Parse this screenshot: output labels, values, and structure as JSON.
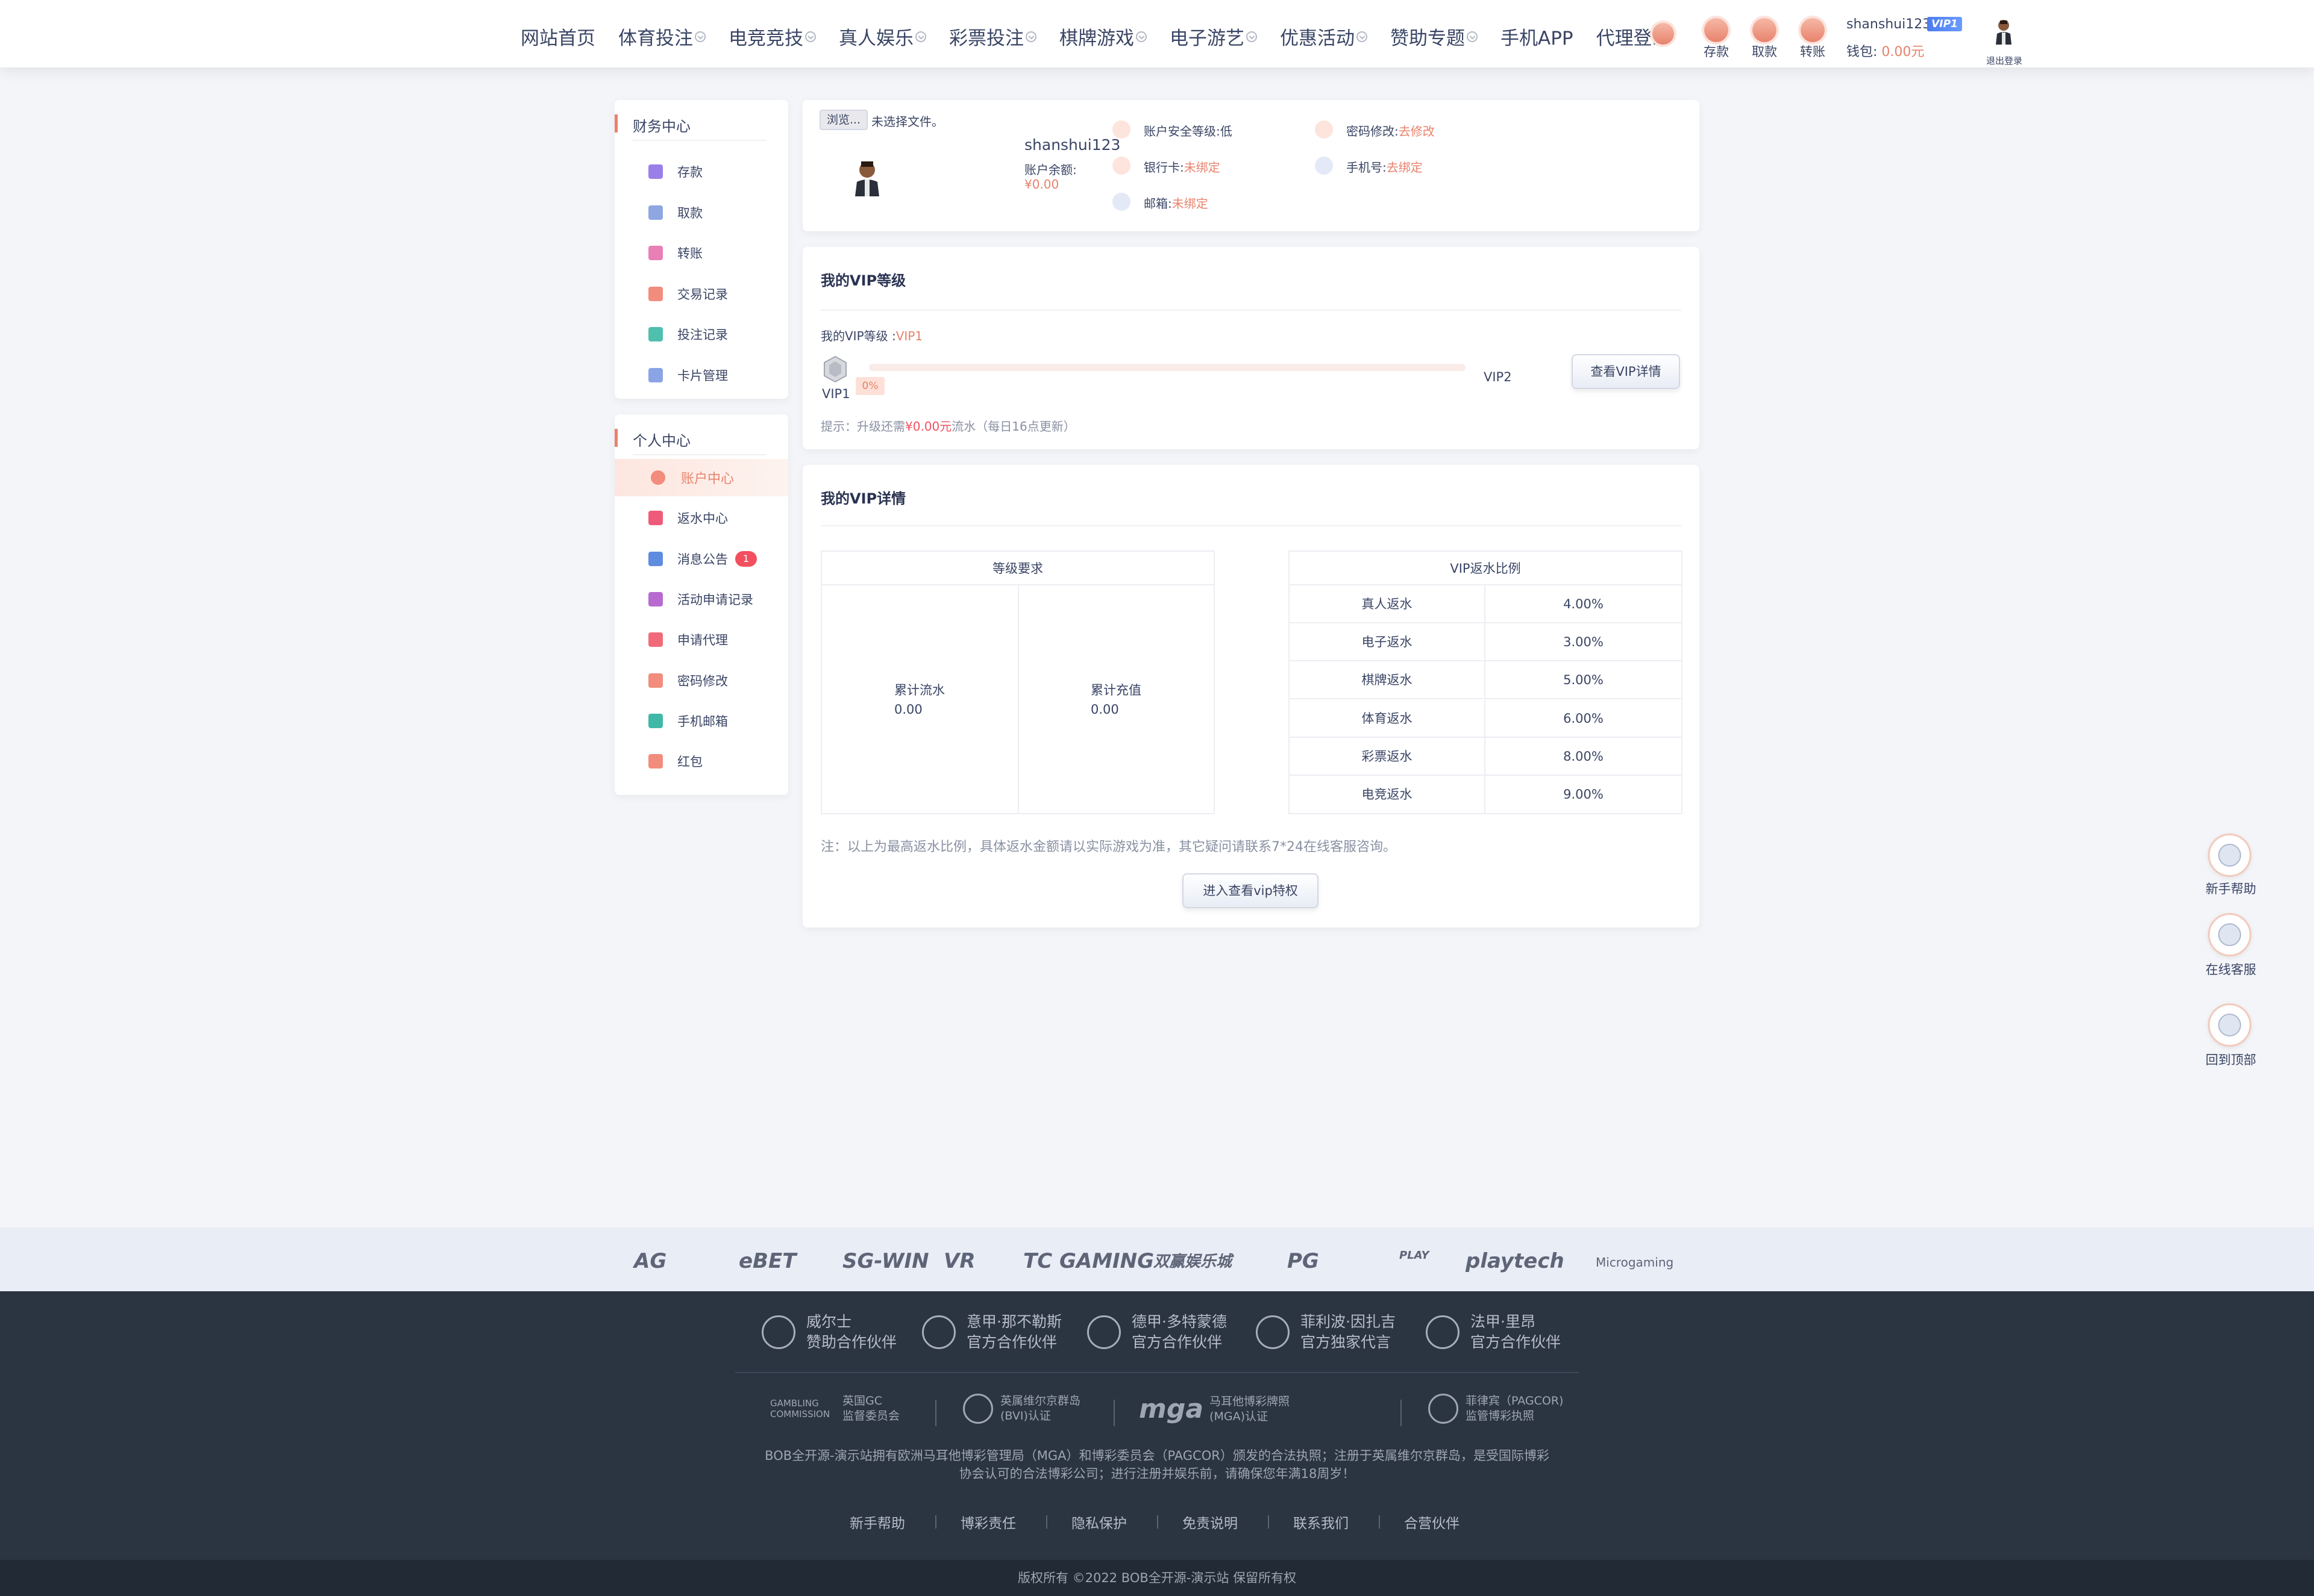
{
  "nav": {
    "items": [
      {
        "label": "网站首页",
        "chev": false
      },
      {
        "label": "体育投注",
        "chev": true
      },
      {
        "label": "电竞竞技",
        "chev": true
      },
      {
        "label": "真人娱乐",
        "chev": true
      },
      {
        "label": "彩票投注",
        "chev": true
      },
      {
        "label": "棋牌游戏",
        "chev": true
      },
      {
        "label": "电子游艺",
        "chev": true
      },
      {
        "label": "优惠活动",
        "chev": true
      },
      {
        "label": "赞助专题",
        "chev": true
      },
      {
        "label": "手机APP",
        "chev": false
      },
      {
        "label": "代理登录",
        "chev": false
      }
    ]
  },
  "header": {
    "deposit": "存款",
    "withdraw": "取款",
    "transfer": "转账",
    "username": "shanshui123",
    "vip_badge": "VIP1",
    "wallet_label": "钱包:",
    "wallet_amount": "0.00",
    "wallet_unit": "元",
    "logout": "退出登录"
  },
  "sidebar": {
    "finance_title": "财务中心",
    "finance_items": [
      "存款",
      "取款",
      "转账",
      "交易记录",
      "投注记录",
      "卡片管理"
    ],
    "personal_title": "个人中心",
    "personal_items": [
      "账户中心",
      "返水中心",
      "消息公告",
      "活动申请记录",
      "申请代理",
      "密码修改",
      "手机邮箱",
      "红包"
    ],
    "message_badge": "1"
  },
  "profile": {
    "browse_btn": "浏览...",
    "no_file": "未选择文件。",
    "username": "shanshui123",
    "balance_label": "账户余额:",
    "balance": "¥0.00",
    "security_label": "账户安全等级:",
    "security_value": "低",
    "password_label": "密码修改:",
    "password_value": "去修改",
    "bank_label": "银行卡:",
    "bank_value": "未绑定",
    "phone_label": "手机号:",
    "phone_value": "去绑定",
    "email_label": "邮箱:",
    "email_value": "未绑定"
  },
  "vip_level": {
    "title": "我的VIP等级",
    "my_level_label": "我的VIP等级 :",
    "my_level_value": "VIP1",
    "current": "VIP1",
    "next": "VIP2",
    "progress": "0%",
    "progress_fraction": 0,
    "detail_btn": "查看VIP详情",
    "tip_prefix": "提示：升级还需",
    "tip_amount": "¥0.00元",
    "tip_suffix": "流水（每日16点更新）"
  },
  "vip_detail": {
    "title": "我的VIP详情",
    "req_header": "等级要求",
    "req_flow_label": "累计流水",
    "req_flow_value": "0.00",
    "req_deposit_label": "累计充值",
    "req_deposit_value": "0.00",
    "rebate_header": "VIP返水比例",
    "rebates": [
      {
        "name": "真人返水",
        "value": "4.00%"
      },
      {
        "name": "电子返水",
        "value": "3.00%"
      },
      {
        "name": "棋牌返水",
        "value": "5.00%"
      },
      {
        "name": "体育返水",
        "value": "6.00%"
      },
      {
        "name": "彩票返水",
        "value": "8.00%"
      },
      {
        "name": "电竞返水",
        "value": "9.00%"
      }
    ],
    "note": "注：以上为最高返水比例，具体返水金额请以实际游戏为准，其它疑问请联系7*24在线客服咨询。",
    "privilege_btn": "进入查看vip特权"
  },
  "float": {
    "help": "新手帮助",
    "service": "在线客服",
    "top": "回到顶部"
  },
  "partners": [
    "AG",
    "eBET",
    "SG-WIN",
    "VR",
    "TC GAMING",
    "双赢娱乐城",
    "PG",
    "PLAY",
    "playtech",
    "Microgaming"
  ],
  "footer": {
    "teams": [
      {
        "name": "威尔士",
        "role": "赞助合作伙伴"
      },
      {
        "name": "意甲·那不勒斯",
        "role": "官方合作伙伴"
      },
      {
        "name": "德甲·多特蒙德",
        "role": "官方合作伙伴"
      },
      {
        "name": "菲利波·因扎吉",
        "role": "官方独家代言"
      },
      {
        "name": "法甲·里昂",
        "role": "官方合作伙伴"
      }
    ],
    "certs": [
      {
        "logo": "GAMBLING COMMISSION",
        "l1": "英国GC",
        "l2": "监督委员会"
      },
      {
        "logo": "",
        "l1": "英属维尔京群岛",
        "l2": "(BVI)认证"
      },
      {
        "logo": "mga",
        "l1": "马耳他博彩牌照",
        "l2": "(MGA)认证"
      },
      {
        "logo": "",
        "l1": "菲律宾（PAGCOR)",
        "l2": "监管博彩执照"
      }
    ],
    "disclaimer_1": "BOB全开源-演示站拥有欧洲马耳他博彩管理局（MGA）和博彩委员会（PAGCOR）颁发的合法执照；注册于英属维尔京群岛，是受国际博彩",
    "disclaimer_2": "协会认可的合法博彩公司；进行注册并娱乐前，请确保您年满18周岁！",
    "links": [
      "新手帮助",
      "博彩责任",
      "隐私保护",
      "免责说明",
      "联系我们",
      "合营伙伴"
    ],
    "copyright": "版权所有 ©2022 BOB全开源-演示站 保留所有权"
  },
  "colors": {
    "accent": "#e8826c",
    "text": "#3a4565",
    "footer_bg": "#2b3441",
    "badge_red": "#f3505f",
    "vip_blue": "#4b7bef"
  }
}
